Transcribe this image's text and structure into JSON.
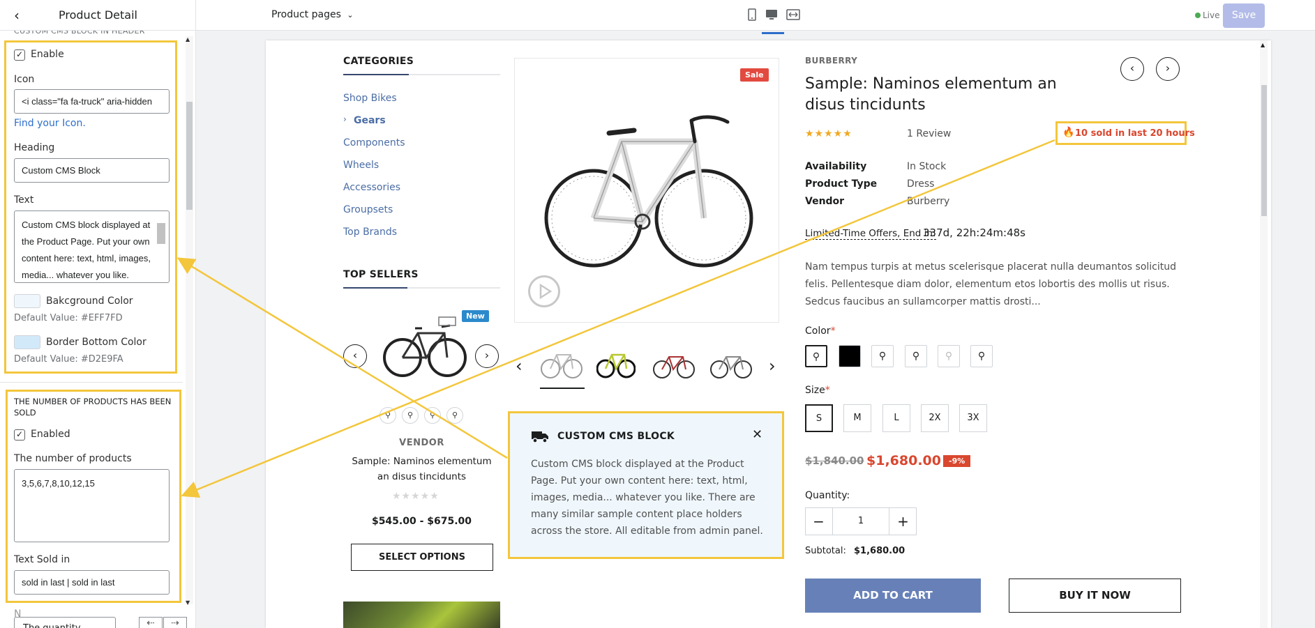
{
  "sidebar": {
    "title": "Product Detail",
    "cut_section": "CUSTOM CMS BLOCK IN HEADER",
    "enable_label": "Enable",
    "icon_label": "Icon",
    "icon_value": "<i class=\"fa fa-truck\" aria-hidden",
    "find_icon_link": "Find your Icon.",
    "heading_label": "Heading",
    "heading_value": "Custom CMS Block",
    "text_label": "Text",
    "text_value": "Custom CMS block displayed at the Product Page. Put your own content here: text, html, images, media... whatever you like.",
    "bg_color_label": "Bakcground Color",
    "bg_color_default": "Default Value: #EFF7FD",
    "bg_color": "#EFF7FD",
    "border_color_label": "Border Bottom Color",
    "border_color_default": "Default Value: #D2E9FA",
    "border_color": "#D2E9FA",
    "sold_section_title": "THE NUMBER OF PRODUCTS HAS BEEN SOLD",
    "enabled_label": "Enabled",
    "number_label": "The number of products",
    "number_value": "3,5,6,7,8,10,12,15",
    "text_sold_label": "Text Sold in",
    "text_sold_value": "sold in last | sold in last",
    "cut_label": "N",
    "footer_button": "The quantity",
    "undo_icon": "undo-icon",
    "redo_icon": "redo-icon"
  },
  "topbar": {
    "page_select": "Product pages",
    "live_label": "Live",
    "save_label": "Save",
    "device_icons": [
      "mobile-icon",
      "desktop-icon",
      "fullwidth-icon"
    ]
  },
  "highlight_color": "#F3C63B",
  "preview": {
    "categories_title": "CATEGORIES",
    "categories": [
      "Shop Bikes",
      "Gears",
      "Components",
      "Wheels",
      "Accessories",
      "Groupsets",
      "Top Brands"
    ],
    "top_sellers_title": "TOP SELLERS",
    "top_seller": {
      "badge": "New",
      "vendor": "VENDOR",
      "name": "Sample: Naminos elementum an disus tincidunts",
      "price": "$545.00 - $675.00",
      "button": "SELECT OPTIONS"
    },
    "sale_badge": "Sale",
    "brand": "BURBERRY",
    "title": "Sample: Naminos elementum an disus tincidunts",
    "rating": 5,
    "reviews": "1 Review",
    "sold_notice": "10 sold in last 20 hours",
    "meta": [
      {
        "label": "Availability",
        "value": "In Stock"
      },
      {
        "label": "Product Type",
        "value": "Dress"
      },
      {
        "label": "Vendor",
        "value": "Burberry"
      }
    ],
    "offer_label": "Limited-Time Offers, End in:",
    "offer_countdown": "337d, 22h:24m:48s",
    "description": "Nam tempus turpis at metus scelerisque placerat nulla deumantos solicitud felis. Pellentesque diam dolor, elementum etos lobortis des mollis ut risus. Sedcus faucibus an sullamcorper mattis drosti...",
    "color_label": "Color",
    "required_mark": "*",
    "size_label": "Size",
    "sizes": [
      "S",
      "M",
      "L",
      "2X",
      "3X"
    ],
    "price_old": "$1,840.00",
    "price_new": "$1,680.00",
    "discount": "-9%",
    "quantity_label": "Quantity:",
    "quantity_value": "1",
    "subtotal_label": "Subtotal:",
    "subtotal_value": "$1,680.00",
    "add_to_cart": "ADD TO CART",
    "buy_now": "BUY IT NOW",
    "price_color": "#D9472F",
    "add_to_cart_color": "#6781B8"
  },
  "cms_block": {
    "title": "CUSTOM CMS BLOCK",
    "text": "Custom CMS block displayed at the Product Page. Put your own content here: text, html, images, media... whatever you like. There are many similar sample content place holders across the store. All editable from admin panel.",
    "icon": "truck-icon",
    "close_icon": "close-icon"
  }
}
